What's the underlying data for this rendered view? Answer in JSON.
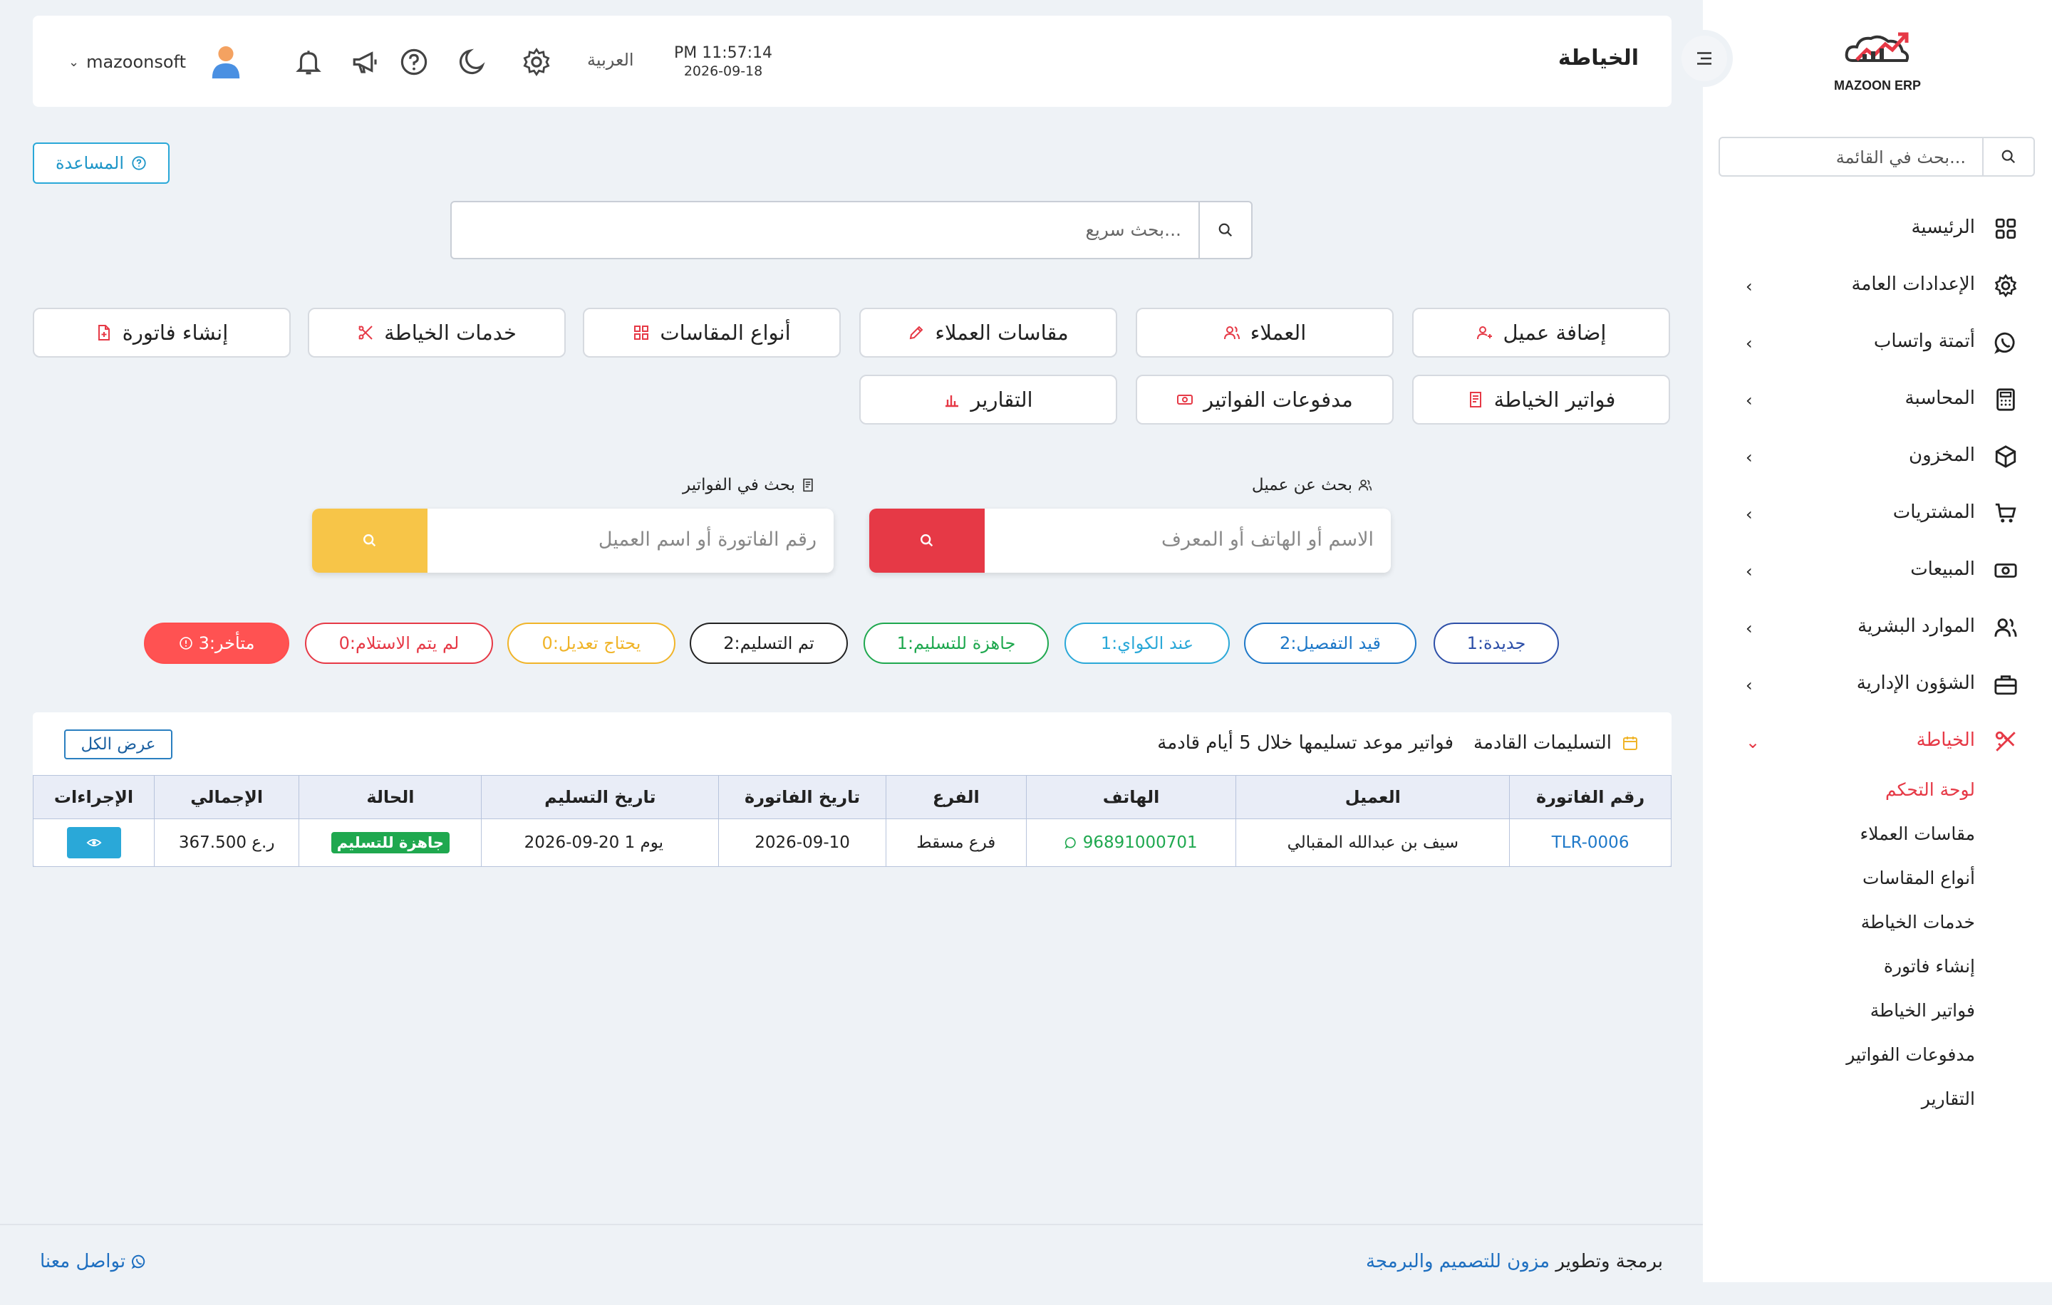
{
  "sidebar": {
    "logo_text": "MAZOON ERP",
    "search_placeholder": "بحث في القائمة...",
    "items": [
      {
        "label": "الرئيسية",
        "icon": "grid-icon",
        "chevron": ""
      },
      {
        "label": "الإعدادات العامة",
        "icon": "gear-icon",
        "chevron": "‹"
      },
      {
        "label": "أتمتة واتساب",
        "icon": "whatsapp-icon",
        "chevron": "‹"
      },
      {
        "label": "المحاسبة",
        "icon": "calculator-icon",
        "chevron": "‹"
      },
      {
        "label": "المخزون",
        "icon": "box-icon",
        "chevron": "‹"
      },
      {
        "label": "المشتريات",
        "icon": "cart-icon",
        "chevron": "‹"
      },
      {
        "label": "المبيعات",
        "icon": "cash-icon",
        "chevron": "‹"
      },
      {
        "label": "الموارد البشرية",
        "icon": "users-icon",
        "chevron": "‹"
      },
      {
        "label": "الشؤون الإدارية",
        "icon": "briefcase-icon",
        "chevron": "‹"
      },
      {
        "label": "الخياطة",
        "icon": "tailoring-icon",
        "chevron": "⌄"
      }
    ],
    "submenu": [
      "لوحة التحكم",
      "مقاسات العملاء",
      "أنواع المقاسات",
      "خدمات الخياطة",
      "إنشاء فاتورة",
      "فواتير الخياطة",
      "مدفوعات الفواتير",
      "التقارير"
    ]
  },
  "topbar": {
    "title": "الخياطة",
    "time": "PM 11:57:14",
    "date": "2026-09-18",
    "language": "العربية",
    "username": "mazoonsoft",
    "user_chevron": "⌄"
  },
  "help_button": "المساعدة",
  "quick_search_placeholder": "بحث سريع...",
  "quick_actions": [
    {
      "label": "إضافة عميل",
      "icon": "user-plus-icon"
    },
    {
      "label": "العملاء",
      "icon": "users-icon"
    },
    {
      "label": "مقاسات العملاء",
      "icon": "pencil-icon"
    },
    {
      "label": "أنواع المقاسات",
      "icon": "grid-icon"
    },
    {
      "label": "خدمات الخياطة",
      "icon": "scissors-icon"
    },
    {
      "label": "إنشاء فاتورة",
      "icon": "file-plus-icon"
    },
    {
      "label": "فواتير الخياطة",
      "icon": "receipt-icon"
    },
    {
      "label": "مدفوعات الفواتير",
      "icon": "money-icon"
    },
    {
      "label": "التقارير",
      "icon": "chart-icon"
    }
  ],
  "customer_search": {
    "label": "بحث عن عميل",
    "placeholder": "الاسم أو الهاتف أو المعرف"
  },
  "invoice_search": {
    "label": "بحث في الفواتير",
    "placeholder": "رقم الفاتورة أو اسم العميل"
  },
  "status_pills": [
    {
      "label": "جديدة:1",
      "color": "#2d4fa8"
    },
    {
      "label": "قيد التفصيل:2",
      "color": "#1e78c8"
    },
    {
      "label": "عند الكواي:1",
      "color": "#2aa8d8"
    },
    {
      "label": "جاهزة للتسليم:1",
      "color": "#1fa84f"
    },
    {
      "label": "تم التسليم:2",
      "color": "#222222"
    },
    {
      "label": "يحتاج تعديل:0",
      "color": "#f0b429"
    },
    {
      "label": "لم يتم الاستلام:0",
      "color": "#e63946"
    },
    {
      "label": "متأخر:3",
      "color": "#ff4d4d"
    }
  ],
  "upcoming": {
    "title": "التسليمات القادمة",
    "subtitle": "فواتير موعد تسليمها خلال 5 أيام قادمة",
    "view_all": "عرض الكل",
    "columns": [
      "رقم الفاتورة",
      "العميل",
      "الهاتف",
      "الفرع",
      "تاريخ الفاتورة",
      "تاريخ التسليم",
      "الحالة",
      "الإجمالي",
      "الإجراءات"
    ],
    "rows": [
      {
        "invoice": "TLR-0006",
        "customer": "سيف بن عبدالله المقبالي",
        "phone": "96891000701",
        "branch": "فرع مسقط",
        "invoice_date": "2026-09-10",
        "delivery_date": "2026-09-20",
        "days_left": "1 يوم",
        "status": "جاهزة للتسليم",
        "total": "367.500 ر.ع"
      }
    ]
  },
  "footer": {
    "credit_prefix": "برمجة وتطوير",
    "credit_link": "مزون للتصميم والبرمجة",
    "contact": "تواصل معنا"
  }
}
